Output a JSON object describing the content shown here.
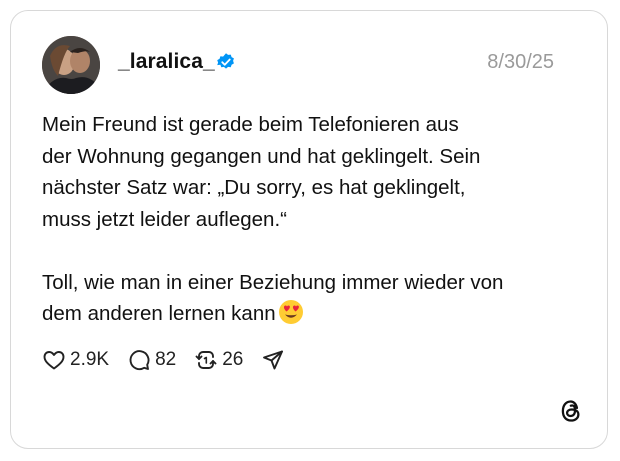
{
  "post": {
    "username": "_laralica_",
    "date": "8/30/25",
    "text": "Mein Freund ist gerade beim Telefonieren aus\nder Wohnung gegangen und hat geklingelt. Sein\nnächster Satz war: „Du sorry, es hat geklingelt,\nmuss jetzt leider auflegen.“\n\nToll, wie man in einer Beziehung immer wieder von\ndem anderen lernen kann",
    "emoji": "heart-eyes-emoji"
  },
  "actions": {
    "likes": "2.9K",
    "comments": "82",
    "reposts": "26"
  },
  "icons": {
    "verified": "verified-badge-icon",
    "like": "heart-icon",
    "comment": "comment-bubble-icon",
    "repost": "repost-icon",
    "share": "send-icon",
    "brand": "threads-logo-icon"
  },
  "colors": {
    "verified": "#0095f6",
    "date": "#9a9a9a",
    "border": "#d8d8d8"
  }
}
